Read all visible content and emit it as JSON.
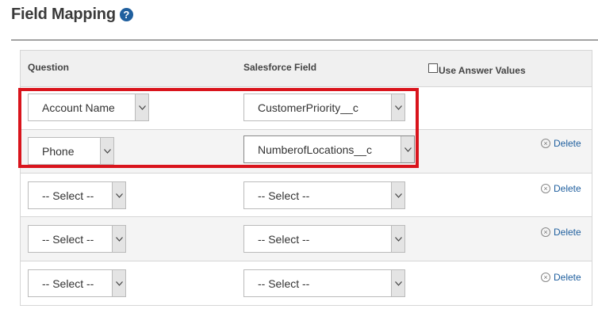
{
  "page": {
    "title": "Field Mapping",
    "help_glyph": "?"
  },
  "table": {
    "headers": {
      "question": "Question",
      "salesforce_field": "Salesforce Field",
      "use_answer_values": "Use Answer Values"
    },
    "rows": [
      {
        "question": "Account Name",
        "salesforce_field": "CustomerPriority__c",
        "delete": ""
      },
      {
        "question": "Phone",
        "salesforce_field": "NumberofLocations__c",
        "delete": "Delete"
      },
      {
        "question": "-- Select --",
        "salesforce_field": "-- Select --",
        "delete": "Delete"
      },
      {
        "question": "-- Select --",
        "salesforce_field": "-- Select --",
        "delete": "Delete"
      },
      {
        "question": "-- Select --",
        "salesforce_field": "-- Select --",
        "delete": "Delete"
      }
    ]
  },
  "colors": {
    "highlight": "#d9141c",
    "link": "#1f5f9e"
  }
}
